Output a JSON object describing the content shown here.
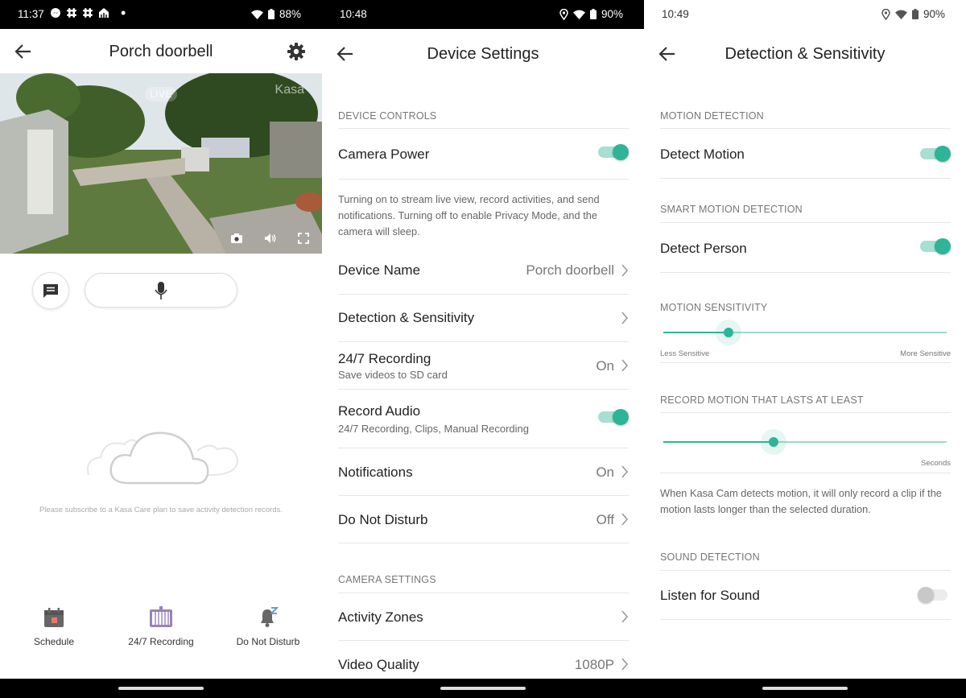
{
  "colors": {
    "accent": "#2eb496",
    "accent_light": "#a7dfd2"
  },
  "panel1": {
    "status": {
      "time": "11:37",
      "battery": "88%"
    },
    "title": "Porch doorbell",
    "video": {
      "live_label": "LIVE",
      "watermark": "Kasa"
    },
    "subscribe_text": "Please subscribe to a Kasa Care plan to save activity detection records.",
    "tabs": [
      {
        "label": "Schedule",
        "icon": "calendar-icon"
      },
      {
        "label": "24/7 Recording",
        "icon": "recording-icon"
      },
      {
        "label": "Do Not Disturb",
        "icon": "bell-snooze-icon"
      }
    ]
  },
  "panel2": {
    "status": {
      "time": "10:48",
      "battery": "90%"
    },
    "title": "Device Settings",
    "sections": {
      "device_controls": "DEVICE CONTROLS",
      "camera_settings": "CAMERA SETTINGS"
    },
    "camera_power": {
      "label": "Camera Power",
      "on": true
    },
    "power_desc": "Turning on to stream live view, record activities, and send notifications. Turning off to enable Privacy Mode, and the camera will sleep.",
    "device_name": {
      "label": "Device Name",
      "value": "Porch doorbell"
    },
    "detection": {
      "label": "Detection & Sensitivity"
    },
    "recording": {
      "label": "24/7 Recording",
      "sub": "Save videos to SD card",
      "value": "On"
    },
    "record_audio": {
      "label": "Record Audio",
      "sub": "24/7 Recording, Clips, Manual Recording",
      "on": true
    },
    "notifications": {
      "label": "Notifications",
      "value": "On"
    },
    "dnd": {
      "label": "Do Not Disturb",
      "value": "Off"
    },
    "activity_zones": {
      "label": "Activity Zones"
    },
    "video_quality": {
      "label": "Video Quality",
      "value": "1080P"
    }
  },
  "panel3": {
    "status": {
      "time": "10:49",
      "battery": "90%"
    },
    "title": "Detection & Sensitivity",
    "sections": {
      "motion": "MOTION DETECTION",
      "smart": "SMART MOTION DETECTION",
      "sensitivity": "MOTION SENSITIVITY",
      "record_lasts": "RECORD MOTION THAT LASTS AT LEAST",
      "sound": "SOUND DETECTION"
    },
    "detect_motion": {
      "label": "Detect Motion",
      "on": true
    },
    "detect_person": {
      "label": "Detect Person",
      "on": true
    },
    "sensitivity": {
      "level": 0.23,
      "min_label": "Less Sensitive",
      "max_label": "More Sensitive"
    },
    "duration": {
      "level": 0.39,
      "unit_label": "Seconds"
    },
    "record_desc": "When Kasa Cam detects motion, it will only record a clip if the motion lasts longer than the selected duration.",
    "listen_sound": {
      "label": "Listen for Sound",
      "on": false
    }
  }
}
